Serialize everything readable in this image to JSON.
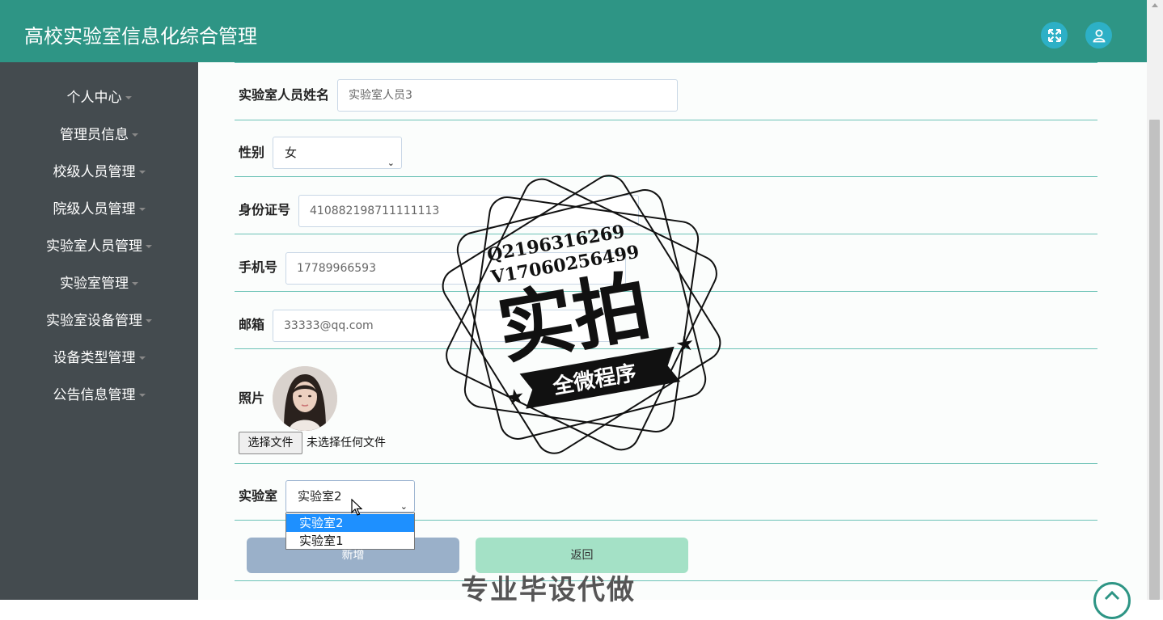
{
  "app": {
    "title": "高校实验室信息化综合管理"
  },
  "header": {
    "icons": [
      "fullscreen-icon",
      "user-icon"
    ]
  },
  "sidebar": {
    "items": [
      {
        "label": "个人中心"
      },
      {
        "label": "管理员信息"
      },
      {
        "label": "校级人员管理"
      },
      {
        "label": "院级人员管理"
      },
      {
        "label": "实验室人员管理"
      },
      {
        "label": "实验室管理"
      },
      {
        "label": "实验室设备管理"
      },
      {
        "label": "设备类型管理"
      },
      {
        "label": "公告信息管理"
      }
    ]
  },
  "form": {
    "name": {
      "label": "实验室人员姓名",
      "value": "实验室人员3"
    },
    "gender": {
      "label": "性别",
      "value": "女"
    },
    "id_number": {
      "label": "身份证号",
      "value": "410882198711111113"
    },
    "phone": {
      "label": "手机号",
      "value": "17789966593"
    },
    "email": {
      "label": "邮箱",
      "value": "33333@qq.com"
    },
    "photo": {
      "label": "照片",
      "file_button": "选择文件",
      "file_status": "未选择任何文件"
    },
    "lab": {
      "label": "实验室",
      "value": "实验室2",
      "options": [
        "实验室2",
        "实验室1"
      ]
    },
    "buttons": {
      "add": "新增",
      "back": "返回"
    }
  },
  "watermark": {
    "line1": "Q2196316269",
    "line2": "V17060256499",
    "big": "实拍",
    "ribbon": "全微程序"
  },
  "footer_text": "专业毕设代做",
  "colors": {
    "header": "#2e9585",
    "sidebar": "#444b4f",
    "divider": "#6cc2b6",
    "add_button": "#9ab0c9",
    "back_button": "#a4e1c6",
    "dropdown_selected": "#1e90ff"
  }
}
